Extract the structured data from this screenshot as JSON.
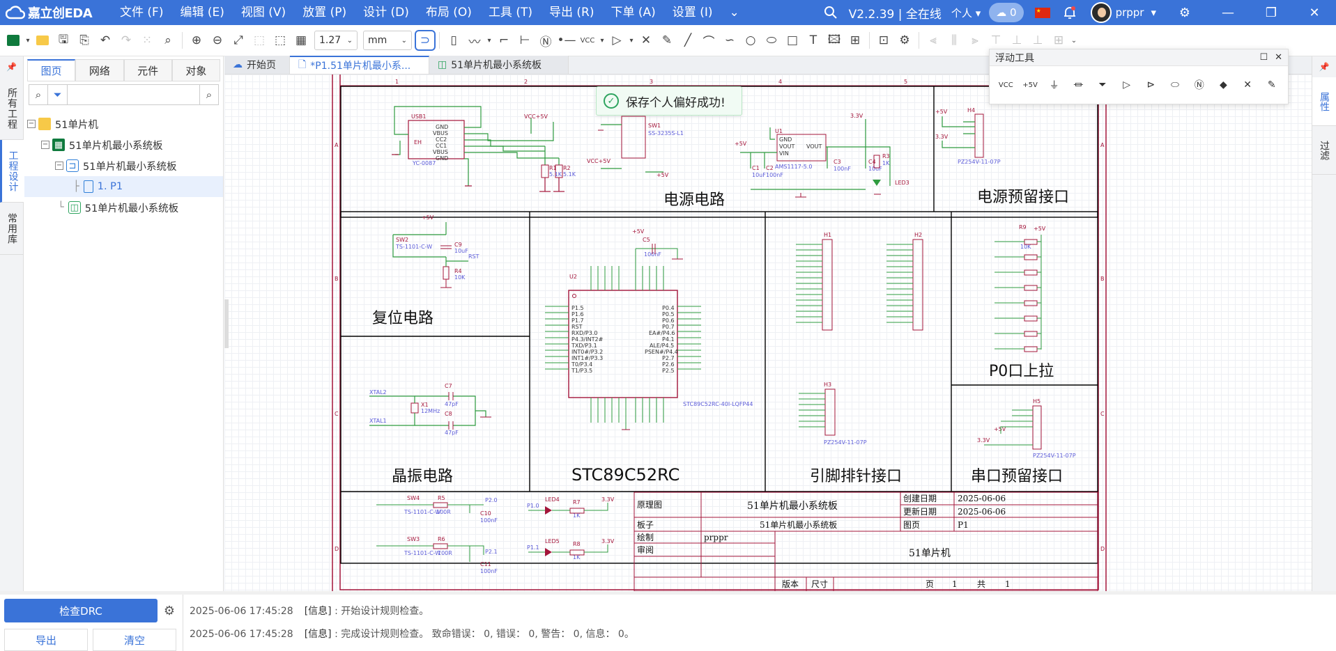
{
  "app": {
    "logo_text": "嘉立创EDA",
    "menus": [
      "文件 (F)",
      "编辑 (E)",
      "视图 (V)",
      "放置 (P)",
      "设计 (D)",
      "布局 (O)",
      "工具 (T)",
      "导出 (R)",
      "下单 (A)",
      "设置 (I)"
    ],
    "version": "V2.2.39 | 全在线",
    "personal": "个人",
    "cloud_count": "0",
    "username": "prppr"
  },
  "toolbar": {
    "zoom_value": "1.27",
    "unit_value": "mm"
  },
  "left_rail": {
    "tabs": [
      "所有工程",
      "工程设计",
      "常用库"
    ]
  },
  "left_panel": {
    "tabs": [
      "图页",
      "网络",
      "元件",
      "对象"
    ],
    "search_placeholder": "",
    "tree": [
      {
        "label": "51单片机",
        "type": "folder"
      },
      {
        "label": "51单片机最小系统板",
        "type": "board"
      },
      {
        "label": "51单片机最小系统板",
        "type": "schematic"
      },
      {
        "label": "1. P1",
        "type": "page"
      },
      {
        "label": "51单片机最小系统板",
        "type": "pcb"
      }
    ]
  },
  "doc_tabs": [
    {
      "label": "开始页"
    },
    {
      "label": "*P1.51单片机最小系..."
    },
    {
      "label": "51单片机最小系统板"
    }
  ],
  "right_rail": {
    "tabs": [
      "属性",
      "过滤"
    ]
  },
  "float_tool": {
    "title": "浮动工具"
  },
  "toast": {
    "message": "保存个人偏好成功!"
  },
  "schematic": {
    "sections": {
      "power": "电源电路",
      "power_reserve": "电源预留接口",
      "reset": "复位电路",
      "mcu": "STC89C52RC",
      "pin_header": "引脚排针接口",
      "p0_pullup": "P0口上拉",
      "crystal": "晶振电路",
      "serial": "串口预留接口"
    },
    "title_block": {
      "label_schematic": "原理图",
      "schematic_name": "51单片机最小系统板",
      "label_created": "创建日期",
      "created": "2025-06-06",
      "label_updated": "更新日期",
      "updated": "2025-06-06",
      "label_board": "板子",
      "board_name": "51单片机最小系统板",
      "label_page": "图页",
      "page": "P1",
      "label_drawn": "绘制",
      "drawn_by": "prppr",
      "label_review": "审阅",
      "project": "51单片机",
      "label_version": "版本",
      "label_size": "尺寸",
      "page_word": "页",
      "page_num": "1",
      "total_word": "共",
      "page_total": "1"
    },
    "parts": {
      "usb": "USB1",
      "usb_part": "YC-0087",
      "usb_pins": [
        "GND",
        "VBUS",
        "CC2",
        "CC1",
        "VBUS",
        "GND"
      ],
      "eh": "EH",
      "r1": "R1",
      "r1v": "5.1K",
      "r2": "R2",
      "r2v": "5.1K",
      "vcc5v": "VCC+5V",
      "sw1": "SW1",
      "sw1_part": "SS-3235S-L1",
      "plus5v": "+5V",
      "u1": "U1",
      "u1_part": "AMS1117-5.0",
      "u1_pins": [
        "GND",
        "VOUT",
        "VIN",
        "VOUT"
      ],
      "c1": "C1",
      "c1v": "10uF",
      "c2": "C2",
      "c2v": "100nF",
      "c3": "C3",
      "c3v": "100nF",
      "c4": "C4",
      "c4v": "10uF",
      "r3": "R3",
      "r3v": "1K",
      "led3": "LED3",
      "v33": "3.3V",
      "h4": "H4",
      "h4_part": "PZ254V-11-07P",
      "sw2": "SW2",
      "sw2_part": "TS-1101-C-W",
      "c9": "C9",
      "c9v": "10uF",
      "rst": "RST",
      "r4": "R4",
      "r4v": "10K",
      "c5": "C5",
      "c5v": "100nF",
      "u2": "U2",
      "u2_part": "STC89C52RC-40I-LQFP44",
      "u2_left_pins": [
        "P1.5",
        "P1.6",
        "P1.7",
        "RST",
        "RXD/P3.0",
        "P4.3/INT2#",
        "TXD/P3.1",
        "INT0#/P3.2",
        "INT1#/P3.3",
        "T0/P3.4",
        "T1/P3.5"
      ],
      "u2_right_pins": [
        "P0.4",
        "P0.5",
        "P0.6",
        "P0.7",
        "EA#/P4.6",
        "P4.1",
        "ALE/P4.5",
        "PSEN#/P4.4",
        "P2.7",
        "P2.6",
        "P2.5"
      ],
      "h1": "H1",
      "h2": "H2",
      "h3": "H3",
      "h3_part": "PZ254V-11-07P",
      "r9": "R9",
      "r9v": "10K",
      "x1": "X1",
      "x1v": "12MHz",
      "xtal2": "XTAL2",
      "xtal1": "XTAL1",
      "c7": "C7",
      "c7v": "47pF",
      "c8": "C8",
      "c8v": "47pF",
      "h5": "H5",
      "h5_part": "PZ254V-11-07P",
      "sw4": "SW4",
      "sw4_part": "TS-1101-C-W",
      "r5": "R5",
      "r5v": "100R",
      "c10": "C10",
      "c10v": "100nF",
      "p20": "P2.0",
      "sw3": "SW3",
      "sw3_part": "TS-1101-C-W",
      "r6": "R6",
      "r6v": "100R",
      "c11": "C11",
      "c11v": "100nF",
      "p21": "P2.1",
      "led4": "LED4",
      "r7": "R7",
      "r7v": "1K",
      "p10": "P1.0",
      "led5": "LED5",
      "r8": "R8",
      "r8v": "1K",
      "p11": "P1.1"
    }
  },
  "bottom": {
    "drc_label": "检查DRC",
    "export_label": "导出",
    "clear_label": "清空",
    "logs": [
      {
        "time": "2025-06-06 17:45:28",
        "level": "[信息]",
        "text": ": 开始设计规则检查。"
      },
      {
        "time": "2025-06-06 17:45:28",
        "level": "[信息]",
        "text": ": 完成设计规则检查。 致命错误： 0, 错误： 0, 警告： 0, 信息： 0。"
      }
    ]
  },
  "colors": {
    "brand": "#3a73d8",
    "frame": "#a3153a",
    "wire": "#2e9b3f",
    "pin": "#5a5ad8"
  }
}
